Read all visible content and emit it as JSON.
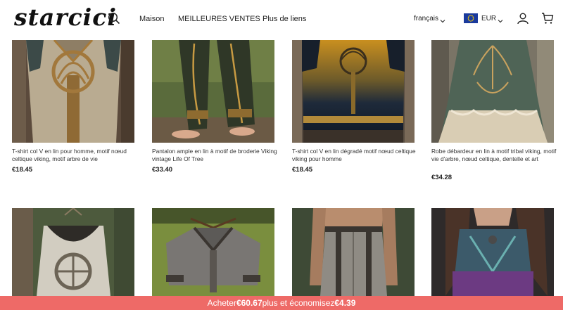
{
  "header": {
    "logo": "starcici",
    "nav": [
      "Maison",
      "MEILLEURES VENTES",
      "Plus de liens"
    ],
    "language": "français",
    "currency": "EUR"
  },
  "products": [
    {
      "title": "T-shirt col V en lin pour homme, motif nœud celtique viking, motif arbre de vie",
      "price": "€18.45"
    },
    {
      "title": "Pantalon ample en lin à motif de broderie Viking vintage Life Of Tree",
      "price": "€33.40"
    },
    {
      "title": "T-shirt col V en lin dégradé motif nœud celtique viking pour homme",
      "price": "€18.45"
    },
    {
      "title": "Robe débardeur en lin à motif tribal viking, motif vie d'arbre, nœud celtique, dentelle et art",
      "price": "€34.28"
    }
  ],
  "promo": {
    "prefix": "Acheter",
    "amount": "€60.67",
    "middle": "plus et économisez",
    "savings": "€4.39"
  },
  "colors": {
    "promo_bg": "#ee6a67",
    "text": "#222222",
    "flag": "#1a3a9c"
  }
}
